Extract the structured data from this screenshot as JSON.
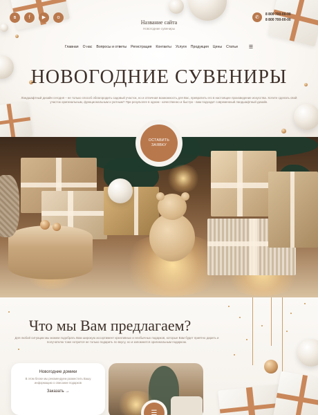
{
  "header": {
    "social": [
      {
        "icon": "vk-icon",
        "glyph": "в"
      },
      {
        "icon": "facebook-icon",
        "glyph": "f"
      },
      {
        "icon": "youtube-icon",
        "glyph": "▶"
      },
      {
        "icon": "odnoklassniki-icon",
        "glyph": "о"
      }
    ],
    "site_title": "Название сайта",
    "site_subtitle": "Новогодние сувениры",
    "phones": [
      "8 800 700-00-00",
      "8 800 700-00-00"
    ]
  },
  "nav": {
    "items": [
      "Главная",
      "О нас",
      "Вопросы и ответы",
      "Регистрация",
      "Контакты",
      "Услуги",
      "Продукция",
      "Цены",
      "Статьи"
    ],
    "burger_icon": "☰"
  },
  "hero": {
    "title": "НОВОГОДНИЕ СУВЕНИРЫ",
    "text": "Ландшафтный дизайн сегодня – не только способ облагородить садовый участок, но и отличная возможность для Вас, превратить его в настоящее произведение искусства. Хотите сделать свой участок оригинальным, функциональным и уютным? При результате в одном - качественно и быстро - вам подходит современный ландшафтный дизайн.",
    "cta_label": "ОСТАВИТЬ ЗАЯВКУ"
  },
  "offer": {
    "title": "Что мы Вам предлагаем?",
    "text": "Для любой ситуации мы можем подобрать Вам широкую ассортимент креативных и необычных подарков, которые Вам будет приятно дарить и получателю тоже нотрится не только подарить по вкусу, но и запомнится оригинальным подарком.",
    "card": {
      "title": "Новогодние домики",
      "text": "В этом блоке мы рекомендуем разместить Вашу информацию о описание подарков",
      "link": "Заказать →"
    },
    "photo_button_icon": "☰"
  },
  "colors": {
    "accent": "#b9784c",
    "title": "#3e3029",
    "muted": "#8e7d70"
  }
}
